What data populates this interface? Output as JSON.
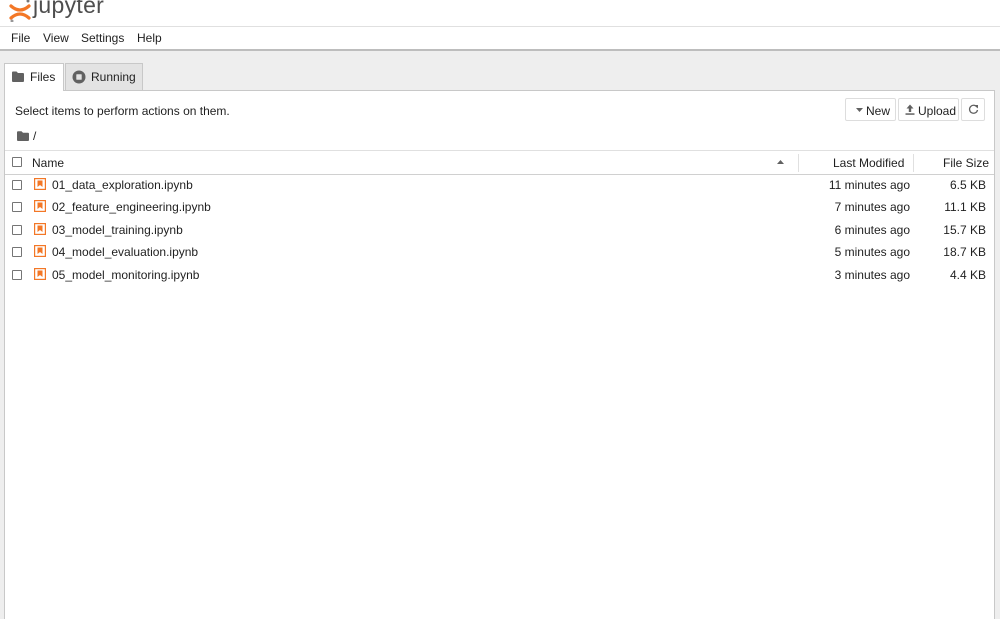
{
  "app": {
    "logo_text": "jupyter",
    "brand_color": "#f37726"
  },
  "menu": [
    {
      "label": "File"
    },
    {
      "label": "View"
    },
    {
      "label": "Settings"
    },
    {
      "label": "Help"
    }
  ],
  "tabs": [
    {
      "label": "Files",
      "icon": "folder-icon",
      "active": true
    },
    {
      "label": "Running",
      "icon": "stop-circle-icon",
      "active": false
    }
  ],
  "toolbar": {
    "hint": "Select items to perform actions on them.",
    "new_label": "New",
    "upload_label": "Upload",
    "refresh_icon": "refresh-icon"
  },
  "breadcrumb": {
    "root_icon": "folder-icon",
    "separator": "/"
  },
  "table": {
    "columns": {
      "name": "Name",
      "modified": "Last Modified",
      "size": "File Size"
    },
    "sort": {
      "column": "name",
      "direction": "ascending"
    },
    "rows": [
      {
        "name": "01_data_exploration.ipynb",
        "modified": "11 minutes ago",
        "size": "6.5 KB"
      },
      {
        "name": "02_feature_engineering.ipynb",
        "modified": "7 minutes ago",
        "size": "11.1 KB"
      },
      {
        "name": "03_model_training.ipynb",
        "modified": "6 minutes ago",
        "size": "15.7 KB"
      },
      {
        "name": "04_model_evaluation.ipynb",
        "modified": "5 minutes ago",
        "size": "18.7 KB"
      },
      {
        "name": "05_model_monitoring.ipynb",
        "modified": "3 minutes ago",
        "size": "4.4 KB"
      }
    ]
  },
  "colors": {
    "notebook_icon": "#f37726",
    "icon_gray": "#616161"
  }
}
